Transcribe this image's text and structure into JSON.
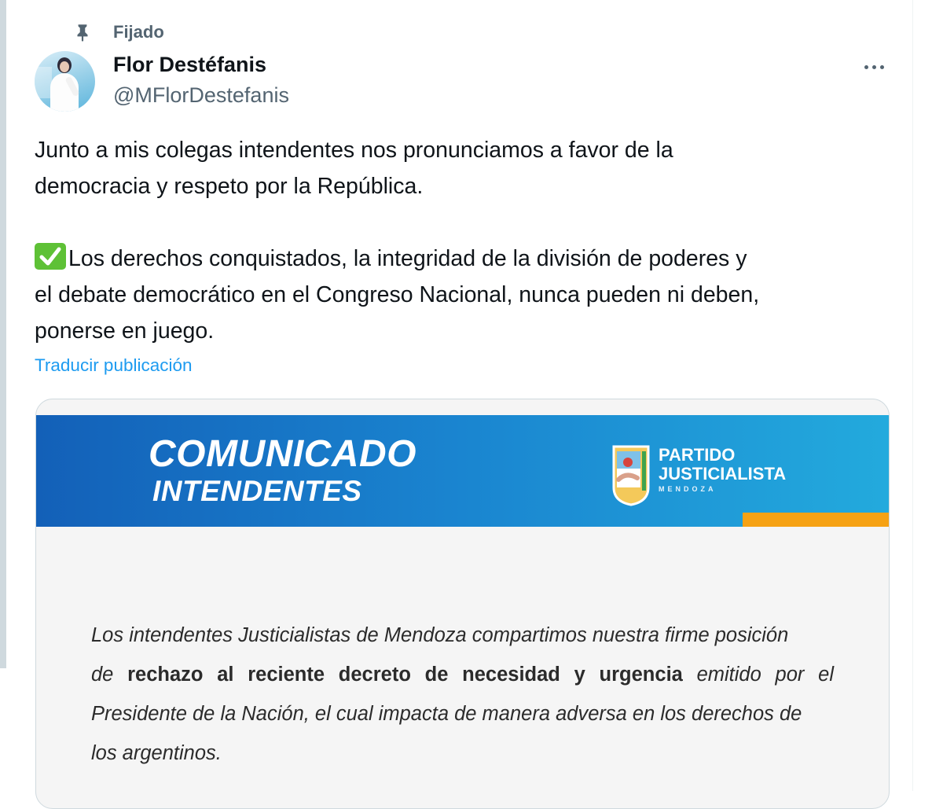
{
  "pinned": {
    "label": "Fijado",
    "icon": "pin-icon"
  },
  "author": {
    "name": "Flor Destéfanis",
    "handle": "@MFlorDestefanis"
  },
  "more_icon": "more-options-icon",
  "tweet": {
    "paragraph1_line1": "Junto a mis colegas intendentes nos pronunciamos a favor de la",
    "paragraph1_line2": "democracia y respeto por la República.",
    "paragraph2_line1": "Los derechos conquistados, la integridad de la división de poderes y",
    "paragraph2_line2": "el debate democrático en el Congreso Nacional, nunca pueden ni deben,",
    "paragraph2_line3": "ponerse en juego.",
    "emoji": "check-mark-button-icon"
  },
  "translate_label": "Traducir publicación",
  "media": {
    "banner_title": "COMUNICADO",
    "banner_subtitle": "INTENDENTES",
    "party_line1": "PARTIDO",
    "party_line2": "JUSTICIALISTA",
    "party_line3": "MENDOZA",
    "body_line1": "Los intendentes Justicialistas de Mendoza compartimos nuestra firme posición",
    "body_line2_pre": "de",
    "body_line2_bold": "rechazo al reciente decreto de necesidad y urgencia",
    "body_line2_post": "emitido por el",
    "body_line3": "Presidente de la Nación, el cual impacta de manera adversa en los derechos de",
    "body_line4": "los argentinos."
  },
  "colors": {
    "link": "#1d9bf0",
    "secondary_text": "#536471",
    "banner_blue": "#1a85d0",
    "banner_orange": "#f6a214"
  }
}
